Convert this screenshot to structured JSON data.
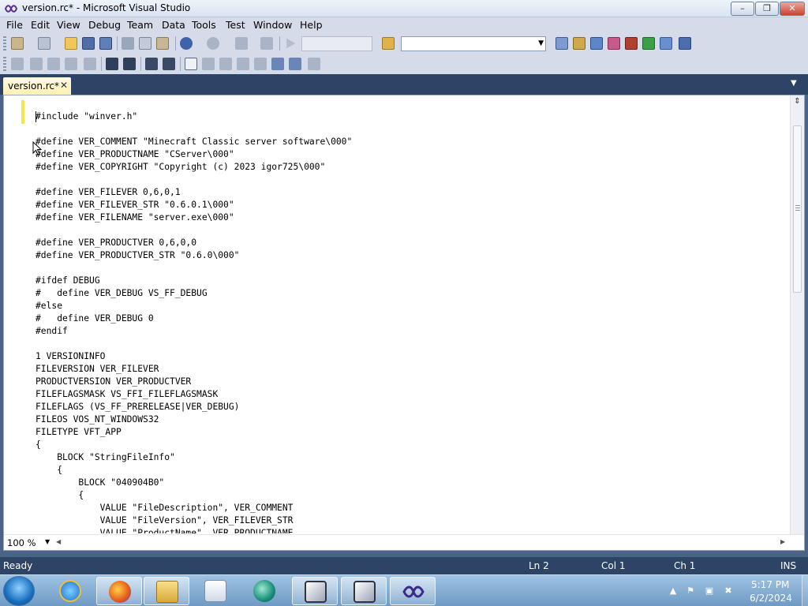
{
  "window": {
    "title": "version.rc* - Microsoft Visual Studio",
    "minimize": "–",
    "maximize": "❐",
    "close": "✕"
  },
  "menu": [
    "File",
    "Edit",
    "View",
    "Debug",
    "Team",
    "Data",
    "Tools",
    "Test",
    "Window",
    "Help"
  ],
  "document_tab": {
    "label": "version.rc*",
    "close": "✕"
  },
  "editor": {
    "lines": [
      "#include \"winver.h\"",
      "",
      "#define VER_COMMENT \"Minecraft Classic server software\\000\"",
      "#define VER_PRODUCTNAME \"CServer\\000\"",
      "#define VER_COPYRIGHT \"Copyright (c) 2023 igor725\\000\"",
      "",
      "#define VER_FILEVER 0,6,0,1",
      "#define VER_FILEVER_STR \"0.6.0.1\\000\"",
      "#define VER_FILENAME \"server.exe\\000\"",
      "",
      "#define VER_PRODUCTVER 0,6,0,0",
      "#define VER_PRODUCTVER_STR \"0.6.0\\000\"",
      "",
      "#ifdef DEBUG",
      "#   define VER_DEBUG VS_FF_DEBUG",
      "#else",
      "#   define VER_DEBUG 0",
      "#endif",
      "",
      "1 VERSIONINFO",
      "FILEVERSION VER_FILEVER",
      "PRODUCTVERSION VER_PRODUCTVER",
      "FILEFLAGSMASK VS_FFI_FILEFLAGSMASK",
      "FILEFLAGS (VS_FF_PRERELEASE|VER_DEBUG)",
      "FILEOS VOS_NT_WINDOWS32",
      "FILETYPE VFT_APP",
      "{",
      "    BLOCK \"StringFileInfo\"",
      "    {",
      "        BLOCK \"040904B0\"",
      "        {",
      "            VALUE \"FileDescription\", VER_COMMENT",
      "            VALUE \"FileVersion\", VER_FILEVER_STR",
      "            VALUE \"ProductName\", VER_PRODUCTNAME"
    ],
    "zoom": "100 %"
  },
  "status": {
    "ready": "Ready",
    "line": "Ln 2",
    "col": "Col 1",
    "ch": "Ch 1",
    "mode": "INS"
  },
  "clock": {
    "time": "5:17 PM",
    "date": "6/2/2024"
  },
  "icons": {
    "toolbar1": [
      "new-project-icon",
      "add-item-icon",
      "open-file-icon",
      "save-icon",
      "save-all-icon",
      "cut-icon",
      "copy-icon",
      "paste-icon",
      "undo-icon",
      "redo-icon",
      "navigate-backward-icon",
      "navigate-forward-icon",
      "start-debugging-icon",
      "find-in-files-icon",
      "solution-explorer-icon",
      "properties-icon",
      "object-browser-icon",
      "toolbox-icon",
      "start-page-icon",
      "extension-manager-icon",
      "options-icon"
    ],
    "toolbar2": [
      "indent-icon",
      "outdent-icon",
      "comment-icon",
      "uncomment-icon",
      "format-icon",
      "bookmark-icon",
      "prev-bookmark-icon",
      "next-bookmark-icon",
      "clear-bookmarks-icon"
    ]
  },
  "colors": {
    "chrome": "#d6dbe9",
    "frame": "#2e4466",
    "tab_active": "#fff1b0",
    "change_marker": "#f5e44a"
  }
}
